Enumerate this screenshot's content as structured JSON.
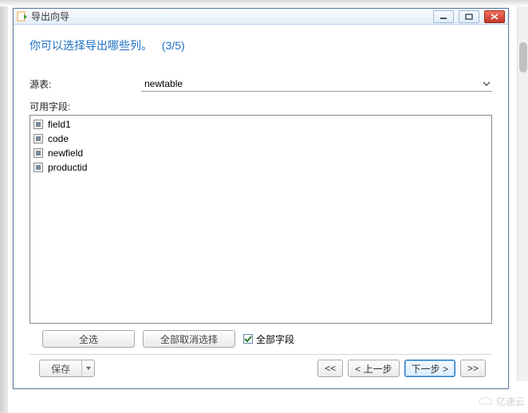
{
  "window": {
    "title": "导出向导"
  },
  "heading": {
    "text": "你可以选择导出哪些列。",
    "step": "(3/5)"
  },
  "source": {
    "label": "源表:",
    "value": "newtable"
  },
  "fields": {
    "label": "可用字段:",
    "items": [
      {
        "label": "field1"
      },
      {
        "label": "code"
      },
      {
        "label": "newfield"
      },
      {
        "label": "productid"
      }
    ]
  },
  "actions": {
    "select_all": "全选",
    "deselect_all": "全部取消选择",
    "all_fields": "全部字段"
  },
  "footer": {
    "save": "保存",
    "first": "<<",
    "back": "< 上一步",
    "next": "下一步 >",
    "last": ">>"
  },
  "watermark": "亿速云"
}
